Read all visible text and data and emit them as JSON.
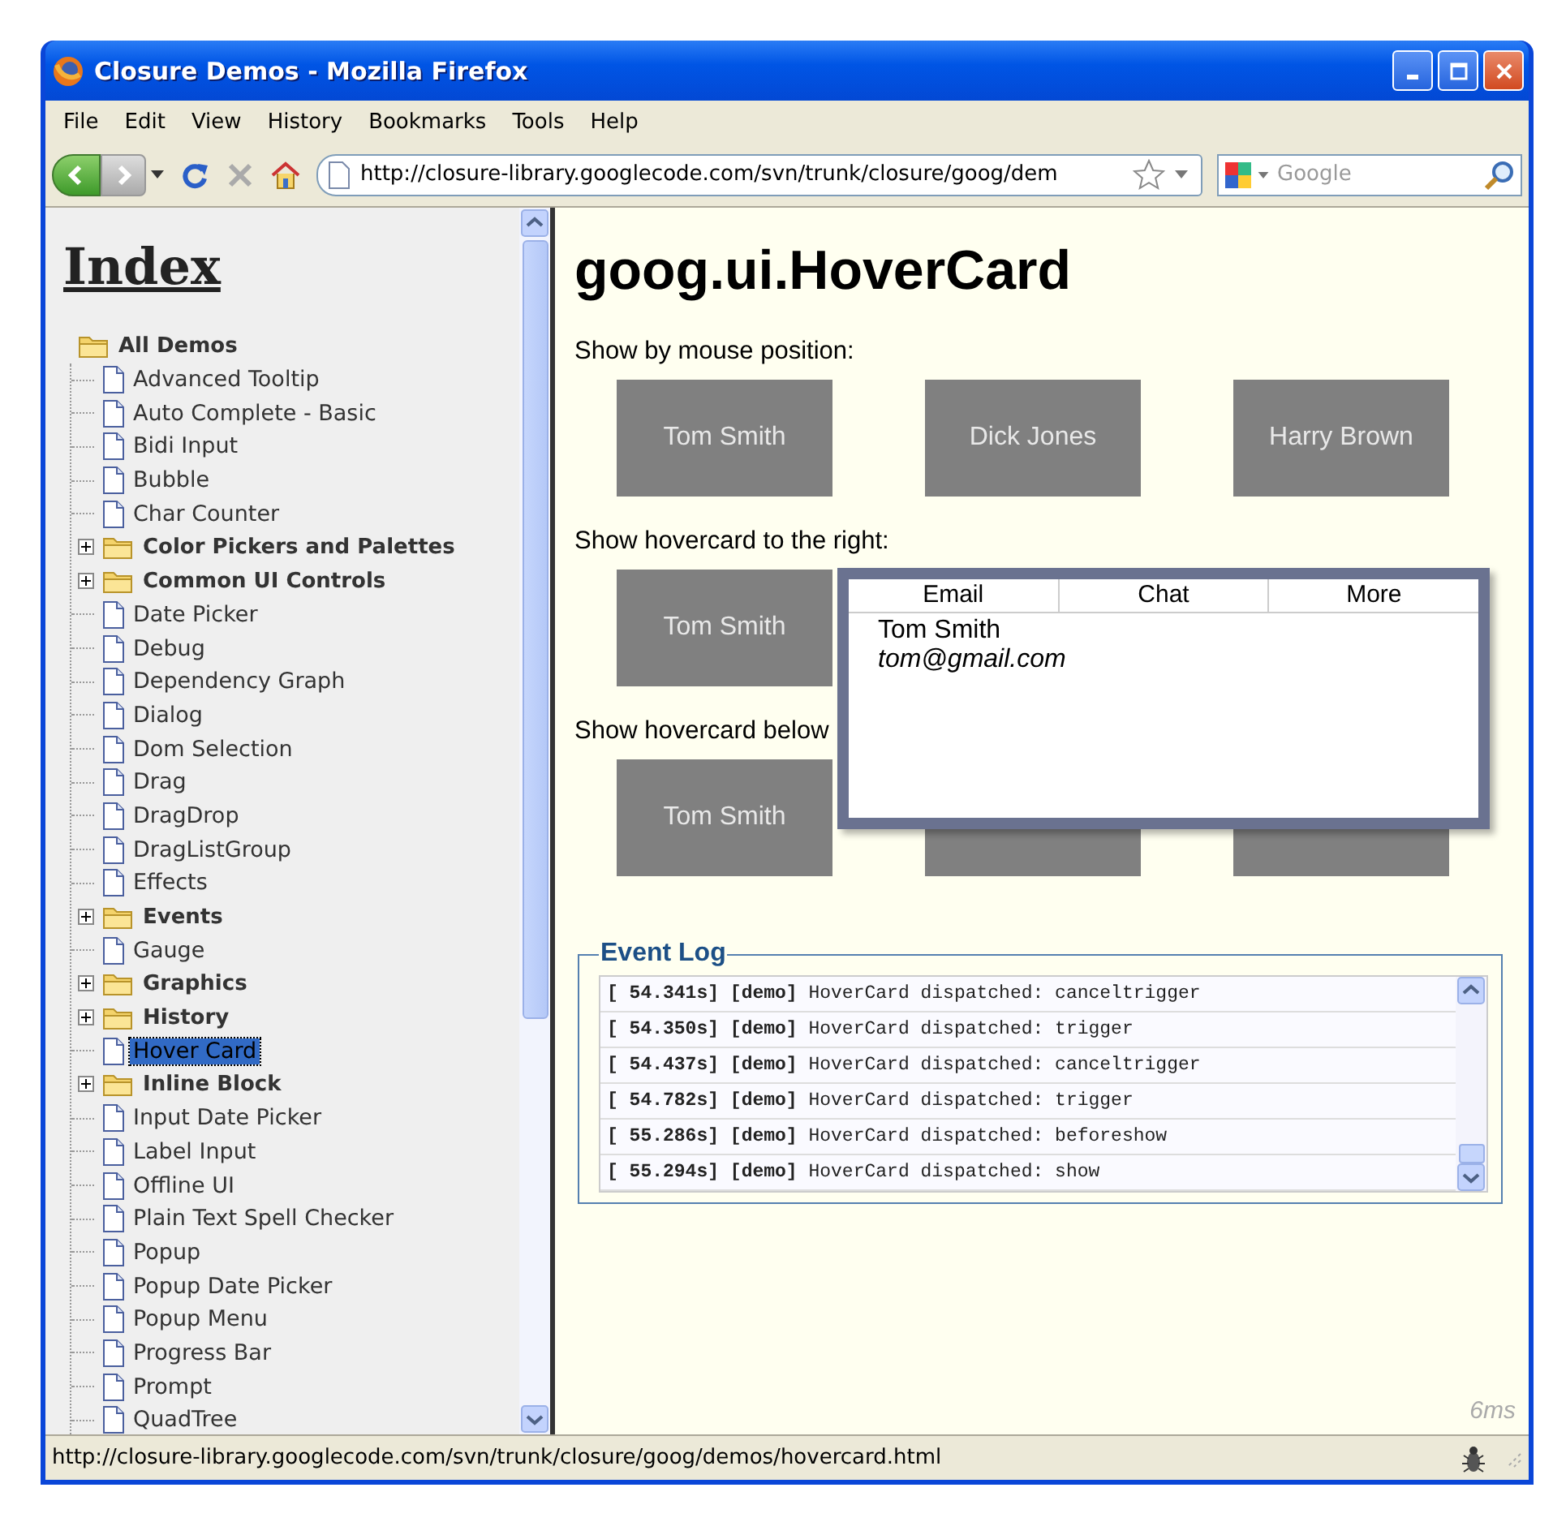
{
  "window": {
    "title": "Closure Demos - Mozilla Firefox"
  },
  "menu": [
    "File",
    "Edit",
    "View",
    "History",
    "Bookmarks",
    "Tools",
    "Help"
  ],
  "toolbar": {
    "url": "http://closure-library.googlecode.com/svn/trunk/closure/goog/dem",
    "search_placeholder": "Google"
  },
  "sidebar": {
    "heading": "Index",
    "tree": [
      {
        "label": "All Demos",
        "kind": "folder",
        "expanded": true,
        "selected": false,
        "children": [
          {
            "label": "Advanced Tooltip",
            "kind": "page",
            "selected": false
          },
          {
            "label": "Auto Complete - Basic",
            "kind": "page",
            "selected": false
          },
          {
            "label": "Bidi Input",
            "kind": "page",
            "selected": false
          },
          {
            "label": "Bubble",
            "kind": "page",
            "selected": false
          },
          {
            "label": "Char Counter",
            "kind": "page",
            "selected": false
          },
          {
            "label": "Color Pickers and Palettes",
            "kind": "folder",
            "expanded": false,
            "selected": false
          },
          {
            "label": "Common UI Controls",
            "kind": "folder",
            "expanded": false,
            "selected": false
          },
          {
            "label": "Date Picker",
            "kind": "page",
            "selected": false
          },
          {
            "label": "Debug",
            "kind": "page",
            "selected": false
          },
          {
            "label": "Dependency Graph",
            "kind": "page",
            "selected": false
          },
          {
            "label": "Dialog",
            "kind": "page",
            "selected": false
          },
          {
            "label": "Dom Selection",
            "kind": "page",
            "selected": false
          },
          {
            "label": "Drag",
            "kind": "page",
            "selected": false
          },
          {
            "label": "DragDrop",
            "kind": "page",
            "selected": false
          },
          {
            "label": "DragListGroup",
            "kind": "page",
            "selected": false
          },
          {
            "label": "Effects",
            "kind": "page",
            "selected": false
          },
          {
            "label": "Events",
            "kind": "folder",
            "expanded": false,
            "selected": false
          },
          {
            "label": "Gauge",
            "kind": "page",
            "selected": false
          },
          {
            "label": "Graphics",
            "kind": "folder",
            "expanded": false,
            "selected": false
          },
          {
            "label": "History",
            "kind": "folder",
            "expanded": false,
            "selected": false
          },
          {
            "label": "Hover Card",
            "kind": "page",
            "selected": true
          },
          {
            "label": "Inline Block",
            "kind": "folder",
            "expanded": false,
            "selected": false
          },
          {
            "label": "Input Date Picker",
            "kind": "page",
            "selected": false
          },
          {
            "label": "Label Input",
            "kind": "page",
            "selected": false
          },
          {
            "label": "Offline UI",
            "kind": "page",
            "selected": false
          },
          {
            "label": "Plain Text Spell Checker",
            "kind": "page",
            "selected": false
          },
          {
            "label": "Popup",
            "kind": "page",
            "selected": false
          },
          {
            "label": "Popup Date Picker",
            "kind": "page",
            "selected": false
          },
          {
            "label": "Popup Menu",
            "kind": "page",
            "selected": false
          },
          {
            "label": "Progress Bar",
            "kind": "page",
            "selected": false
          },
          {
            "label": "Prompt",
            "kind": "page",
            "selected": false
          },
          {
            "label": "QuadTree",
            "kind": "page",
            "selected": false
          }
        ]
      }
    ]
  },
  "main": {
    "title": "goog.ui.HoverCard",
    "sections": [
      {
        "label": "Show by mouse position:",
        "buttons": [
          {
            "label": "Tom Smith"
          },
          {
            "label": "Dick Jones"
          },
          {
            "label": "Harry Brown"
          }
        ]
      },
      {
        "label": "Show hovercard to the right:",
        "buttons": [
          {
            "label": "Tom Smith"
          }
        ]
      },
      {
        "label": "Show hovercard below",
        "buttons": [
          {
            "label": "Tom Smith",
            "covered": false
          },
          {
            "covered": true
          },
          {
            "covered": true
          }
        ]
      }
    ],
    "hovercard": {
      "tabs": [
        "Email",
        "Chat",
        "More"
      ],
      "name": "Tom Smith",
      "email": "tom@gmail.com"
    },
    "event_log": {
      "legend": "Event Log",
      "entries": [
        "**[ 54.341s] [demo]** HoverCard dispatched: canceltrigger",
        "**[ 54.350s] [demo]** HoverCard dispatched: trigger",
        "**[ 54.437s] [demo]** HoverCard dispatched: canceltrigger",
        "**[ 54.782s] [demo]** HoverCard dispatched: trigger",
        "**[ 55.286s] [demo]** HoverCard dispatched: beforeshow",
        "**[ 55.294s] [demo]** HoverCard dispatched: show"
      ]
    },
    "timing": "6ms"
  },
  "status_bar": {
    "text": "http://closure-library.googlecode.com/svn/trunk/closure/goog/demos/hovercard.html"
  }
}
